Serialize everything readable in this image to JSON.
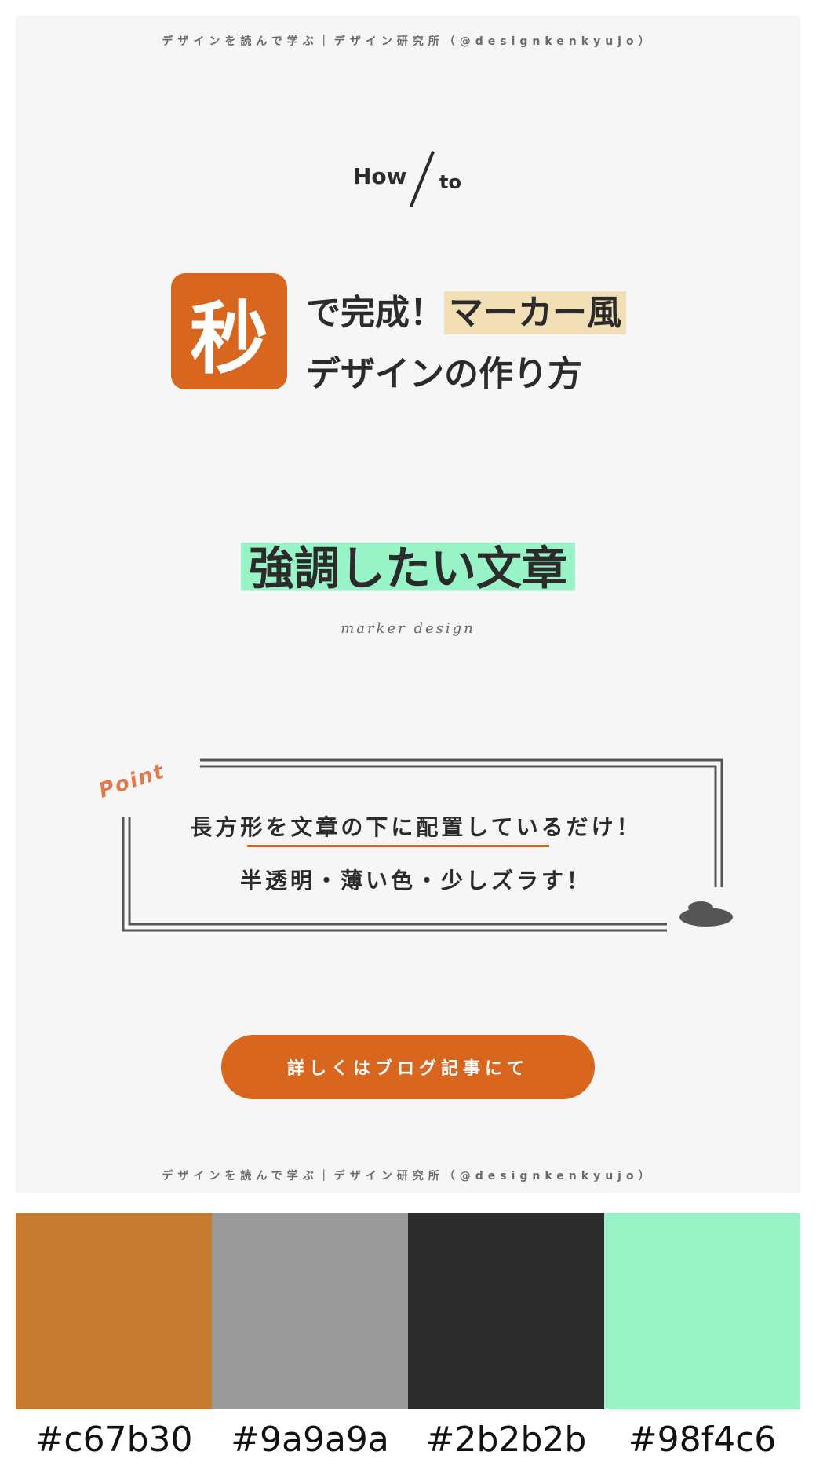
{
  "card": {
    "tagline_top": "デザインを読んで学ぶ｜デザイン研究所（@designkenkyujo）",
    "tagline_bottom": "デザインを読んで学ぶ｜デザイン研究所（@designkenkyujo）",
    "howto_how": "How",
    "howto_to": "to",
    "badge_char": "秒",
    "title_line1_prefix": "で完成！",
    "title_line1_highlight": "マーカー風",
    "title_line2": "デザインの作り方",
    "main_phrase": "強調したい文章",
    "sub_caption": "marker design",
    "point_label": "Point",
    "tip_line1": "長方形を文章の下に配置しているだけ！",
    "tip_line2": "半透明・薄い色・少しズラす！",
    "cta_label": "詳しくはブログ記事にて"
  },
  "palette": [
    {
      "hex": "#c67b30"
    },
    {
      "hex": "#9a9a9a"
    },
    {
      "hex": "#2b2b2b"
    },
    {
      "hex": "#98f4c6"
    }
  ],
  "colors": {
    "accent_orange": "#d9661e",
    "marker_green": "#98f4c6",
    "marker_peach": "#f3dfb6",
    "text_dark": "#2b2b2b"
  }
}
